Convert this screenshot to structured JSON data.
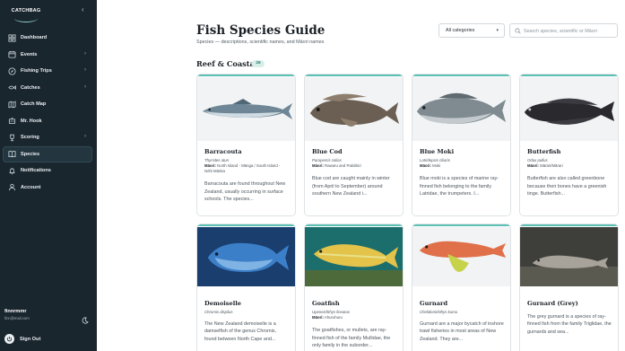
{
  "sidebar": {
    "logo_text": "CATCHBAG",
    "collapse_icon": "chevron-left-icon",
    "items": [
      {
        "label": "Dashboard",
        "icon": "grid-icon",
        "chevron": false
      },
      {
        "label": "Events",
        "icon": "calendar-icon",
        "chevron": true
      },
      {
        "label": "Fishing Trips",
        "icon": "compass-icon",
        "chevron": true
      },
      {
        "label": "Catches",
        "icon": "fish-icon",
        "chevron": true
      },
      {
        "label": "Catch Map",
        "icon": "map-icon",
        "chevron": false
      },
      {
        "label": "Mr. Hook",
        "icon": "bot-icon",
        "chevron": false
      },
      {
        "label": "Scoring",
        "icon": "trophy-icon",
        "chevron": true
      },
      {
        "label": "Species",
        "icon": "book-icon",
        "chevron": false,
        "active": true
      },
      {
        "label": "Notifications",
        "icon": "bell-icon",
        "chevron": false
      },
      {
        "label": "Account",
        "icon": "user-icon",
        "chevron": false
      }
    ],
    "user": {
      "name": "finnrmmr",
      "email": "finn@mail.com"
    },
    "signout_label": "Sign Out"
  },
  "header": {
    "title": "Fish Species Guide",
    "subtitle": "Species — descriptions, scientific names, and Māori names",
    "category_select": "All categories",
    "search_placeholder": "Search species, scientific or Māori"
  },
  "section": {
    "title": "Reef & Coastal",
    "count": "26"
  },
  "species": [
    {
      "name": "Barracouta",
      "scientific": "Thyrsites atun",
      "maori_label": "Māori:",
      "maori": "North Island - Mānga / South Island - Nōhi Mānka",
      "description": "Barracouta are found throughout New Zealand, usually occurring in surface schools. The species..."
    },
    {
      "name": "Blue Cod",
      "scientific": "Parapercis colias",
      "maori_label": "Māori:",
      "maori": "Rawaru and Pakirikiri",
      "description": "Blue cod are caught mainly in winter (from April to September) around southern New Zealand i..."
    },
    {
      "name": "Blue Moki",
      "scientific": "Latridopsis ciliaris",
      "maori_label": "Māori:",
      "maori": "Moki",
      "description": "Blue moki is a species of marine ray-finned fish belonging to the family Latridae, the trumpeters. I..."
    },
    {
      "name": "Butterfish",
      "scientific": "Odax pullus",
      "maori_label": "Māori:",
      "maori": "Mārari/Mārari",
      "description": "Butterfish are also called greenbone because their bones have a greenish tinge. Butterfish..."
    },
    {
      "name": "Demoiselle",
      "scientific": "Chromis dispilus",
      "maori_label": "",
      "maori": "",
      "description": "The New Zealand demoiselle is a damselfish of the genus Chromis, found between North Cape and..."
    },
    {
      "name": "Goatfish",
      "scientific": "Upeneichthys lineatus",
      "maori_label": "Māori:",
      "maori": "Ahuruhuru",
      "description": "The goatfishes, or mullets, are ray-finned fish of the family Mullidae, the only family in the suborder..."
    },
    {
      "name": "Gurnard",
      "scientific": "Chelidonichthys kumu",
      "maori_label": "",
      "maori": "",
      "description": "Gurnard are a major bycatch of inshore trawl fisheries in most areas of New Zealand. They are..."
    },
    {
      "name": "Gurnard (Grey)",
      "scientific": "",
      "maori_label": "",
      "maori": "",
      "description": "The grey gurnard is a species of ray-finned fish from the family Triglidae, the gurnards and sea..."
    }
  ],
  "colors": {
    "sidebar_bg": "#1a262e",
    "accent": "#5bc0b4",
    "badge_bg": "#d7efe9"
  }
}
